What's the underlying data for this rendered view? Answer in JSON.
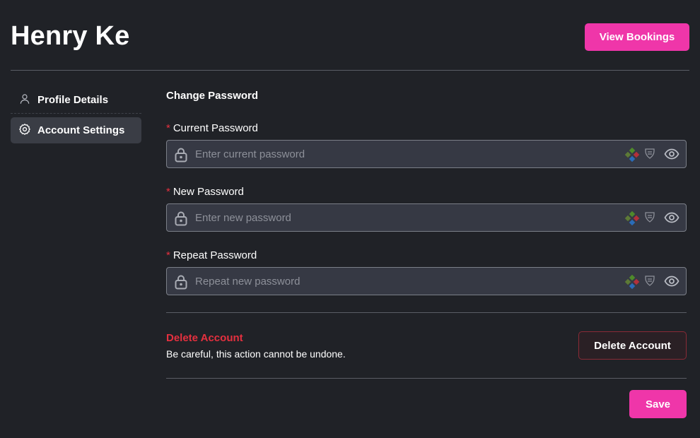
{
  "header": {
    "user_name": "Henry Ke",
    "view_bookings_label": "View Bookings"
  },
  "sidebar": {
    "items": [
      {
        "label": "Profile Details",
        "icon": "user-icon",
        "active": false
      },
      {
        "label": "Account Settings",
        "icon": "gear-icon",
        "active": true
      }
    ]
  },
  "change_password": {
    "title": "Change Password",
    "required_mark": "*",
    "fields": [
      {
        "label": "Current Password",
        "placeholder": "Enter current password",
        "value": ""
      },
      {
        "label": "New Password",
        "placeholder": "Enter new password",
        "value": ""
      },
      {
        "label": "Repeat Password",
        "placeholder": "Repeat new password",
        "value": ""
      }
    ]
  },
  "delete_account": {
    "title": "Delete Account",
    "description": "Be careful, this action cannot be undone.",
    "button_label": "Delete Account"
  },
  "footer": {
    "save_label": "Save"
  },
  "colors": {
    "background": "#202227",
    "accent": "#ef36a9",
    "danger": "#e5303f",
    "input_bg": "#363944",
    "sidebar_active": "#3a3d45"
  }
}
